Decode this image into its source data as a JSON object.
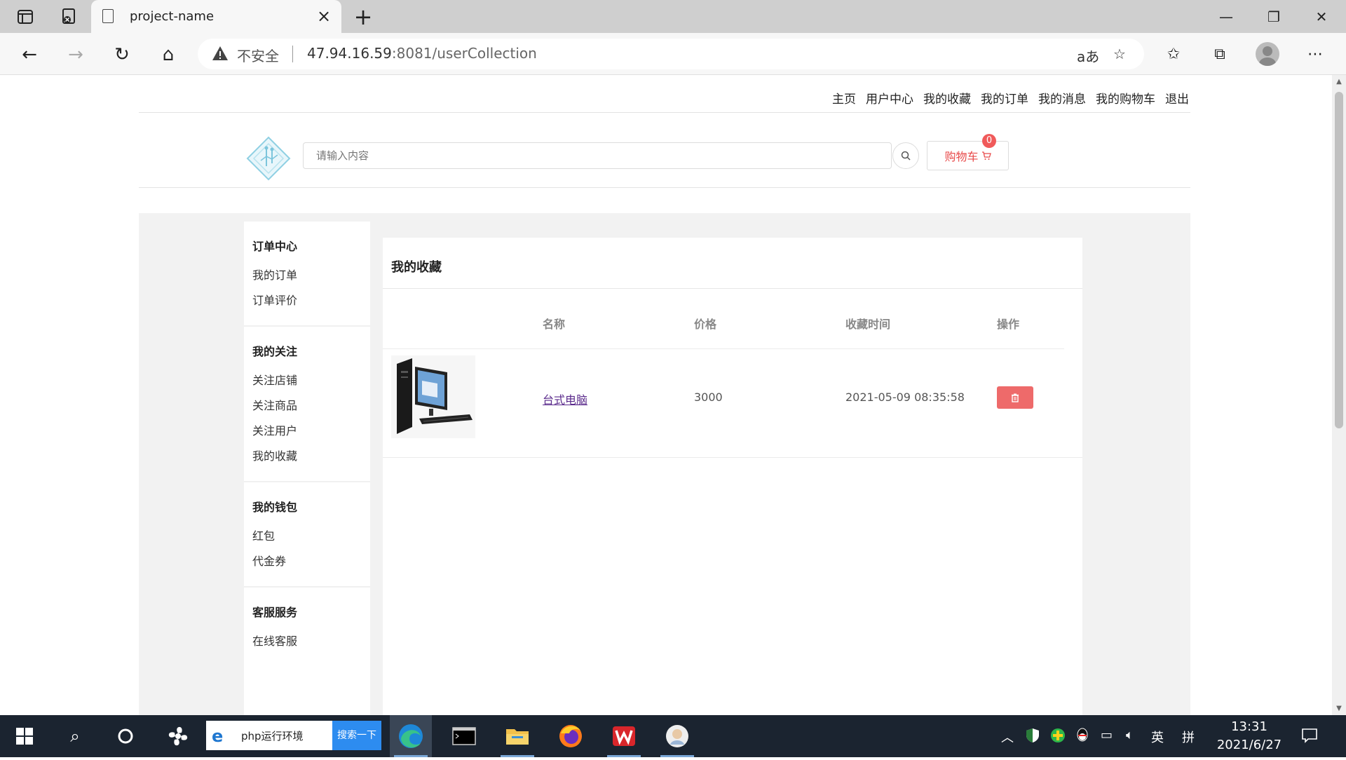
{
  "browser": {
    "tab_title": "project-name",
    "new_tab_symbol": "+",
    "insecure_label": "不安全",
    "url_host": "47.94.16.59",
    "url_port_path": ":8081/userCollection",
    "read_aloud_label": "aあ"
  },
  "topnav": {
    "items": [
      "主页",
      "用户中心",
      "我的收藏",
      "我的订单",
      "我的消息",
      "我的购物车",
      "退出"
    ]
  },
  "search": {
    "placeholder": "请输入内容"
  },
  "cart": {
    "label": "购物车",
    "count": "0"
  },
  "sidebar": {
    "groups": [
      {
        "title": "订单中心",
        "items": [
          "我的订单",
          "订单评价"
        ]
      },
      {
        "title": "我的关注",
        "items": [
          "关注店铺",
          "关注商品",
          "关注用户",
          "我的收藏"
        ]
      },
      {
        "title": "我的钱包",
        "items": [
          "红包",
          "代金券"
        ]
      },
      {
        "title": "客服服务",
        "items": [
          "在线客服"
        ]
      }
    ]
  },
  "main": {
    "title": "我的收藏",
    "columns": [
      "名称",
      "价格",
      "收藏时间",
      "操作"
    ],
    "rows": [
      {
        "name": "台式电脑",
        "price": "3000",
        "time": "2021-05-09 08:35:58"
      }
    ]
  },
  "taskbar": {
    "search_text": "php运行环境",
    "search_button": "搜索一下",
    "ime_label": "英",
    "ime_mode": "拼",
    "time": "13:31",
    "date": "2021/6/27"
  },
  "colors": {
    "accent_red": "#e84a4a",
    "delete_button": "#ee6a6a",
    "taskbar": "#1b2430"
  }
}
